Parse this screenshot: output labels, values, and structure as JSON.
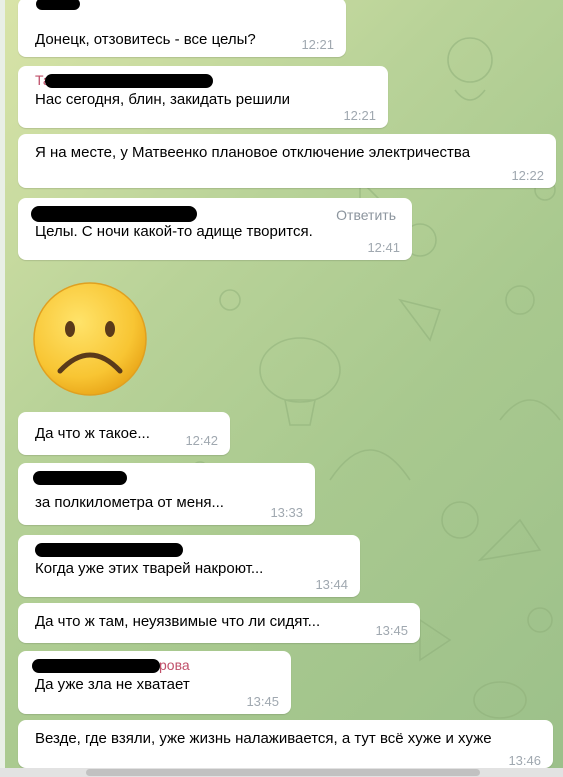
{
  "messages": [
    {
      "text": "Донецк, отзовитесь - все целы?",
      "time": "12:21"
    },
    {
      "sender_peek": "Тат",
      "text": "Нас сегодня, блин, закидать решили",
      "time": "12:21"
    },
    {
      "text": "Я на месте, у Матвеенко плановое отключение электричества",
      "time": "12:22"
    },
    {
      "text": "Целы. С ночи какой-то адище творится.",
      "time": "12:41",
      "reply_label": "Ответить"
    },
    {
      "text": "Да что ж такое...",
      "time": "12:42"
    },
    {
      "text": "за полкилометра от меня...",
      "time": "13:33"
    },
    {
      "text": "Когда уже этих тварей накроют...",
      "time": "13:44"
    },
    {
      "text": "Да что ж там, неуязвимые что ли сидят...",
      "time": "13:45"
    },
    {
      "sender_peek": "рова",
      "text": "Да уже зла не хватает",
      "time": "13:45"
    },
    {
      "text": "Везде, где взяли, уже жизнь налаживается, а тут всё хуже и хуже",
      "time": "13:46"
    }
  ],
  "sticker": {
    "name": "sad-face-emoji"
  },
  "colors": {
    "bubble": "#ffffff",
    "wallpaper": "#b8d298",
    "time": "#a0a8b0",
    "sender": "#c0506a"
  }
}
